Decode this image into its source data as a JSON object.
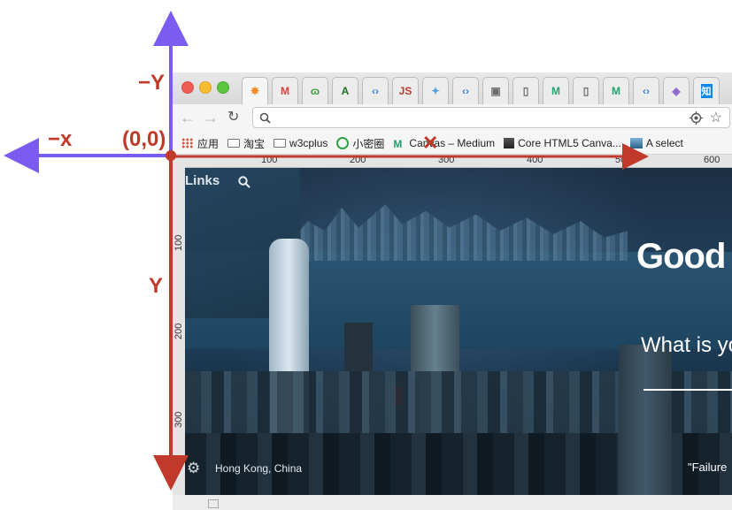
{
  "annotations": {
    "neg_y": "−Y",
    "neg_x": "−x",
    "origin": "(0,0)",
    "y": "Y",
    "x": "X",
    "label_color": "#c0392b",
    "neg_axis_color": "#7b5cf0",
    "pos_axis_color": "#c0392b"
  },
  "browser": {
    "tabs": [
      {
        "icon": "dribbble-like-icon",
        "glyph": "✸",
        "color": "#f08a24"
      },
      {
        "icon": "medium-m-icon",
        "glyph": "M",
        "color": "#d9423c"
      },
      {
        "icon": "spiral-icon",
        "glyph": "ɷ",
        "color": "#3a9b3a"
      },
      {
        "icon": "green-a-icon",
        "glyph": "A",
        "color": "#1f6f1f"
      },
      {
        "icon": "angle-brackets-icon",
        "glyph": "‹›",
        "color": "#3b82d6"
      },
      {
        "icon": "js-icon",
        "glyph": "JS",
        "color": "#c0392b"
      },
      {
        "icon": "kite-icon",
        "glyph": "✦",
        "color": "#5aa0d8"
      },
      {
        "icon": "angle-brackets-icon",
        "glyph": "‹›",
        "color": "#3b82d6"
      },
      {
        "icon": "image-thumb-icon",
        "glyph": "▣",
        "color": "#6a6a6a"
      },
      {
        "icon": "document-icon",
        "glyph": "▯",
        "color": "#6a6a6a"
      },
      {
        "icon": "medium-green-icon",
        "glyph": "M",
        "color": "#23a26b"
      },
      {
        "icon": "document-icon",
        "glyph": "▯",
        "color": "#6a6a6a"
      },
      {
        "icon": "medium-green-icon",
        "glyph": "M",
        "color": "#23a26b"
      },
      {
        "icon": "angle-brackets-icon",
        "glyph": "‹›",
        "color": "#3b82d6"
      },
      {
        "icon": "diamond-icon",
        "glyph": "◈",
        "color": "#8a62c9"
      },
      {
        "icon": "zhihu-icon",
        "glyph": "知",
        "color": "#ffffff"
      }
    ],
    "omnibox_value": "",
    "bookmarks": [
      {
        "label": "应用",
        "icon": "apps-grid-icon"
      },
      {
        "label": "淘宝",
        "icon": "folder-icon"
      },
      {
        "label": "w3cplus",
        "icon": "folder-icon"
      },
      {
        "label": "小密圈",
        "icon": "circle-loop-icon"
      },
      {
        "label": "Canvas – Medium",
        "icon": "medium-green-icon"
      },
      {
        "label": "Core HTML5 Canva...",
        "icon": "book-icon"
      },
      {
        "label": "A select",
        "icon": "image-thumb-icon"
      }
    ],
    "ruler_top": [
      "100",
      "200",
      "300",
      "400",
      "500",
      "600"
    ],
    "ruler_left": [
      "100",
      "200",
      "300"
    ]
  },
  "page": {
    "links": "Links",
    "headline": "Good",
    "question": "What is yo",
    "location": "Hong Kong, China",
    "quote": "\"Failure"
  }
}
